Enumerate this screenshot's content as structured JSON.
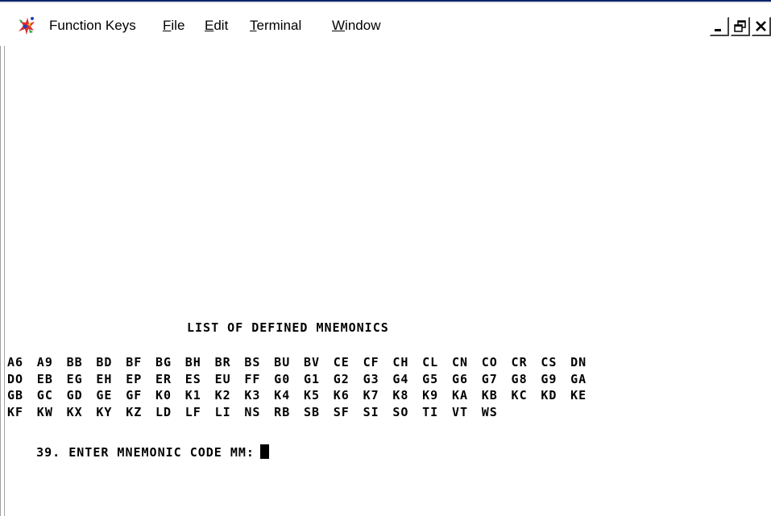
{
  "menubar": {
    "app_icon": "colorful-swirl-app-icon",
    "items": [
      {
        "label": "Function Keys",
        "accel": ""
      },
      {
        "label": "File",
        "accel": "F"
      },
      {
        "label": "Edit",
        "accel": "E"
      },
      {
        "label": "Terminal",
        "accel": "T"
      },
      {
        "label": "Window",
        "accel": "W"
      }
    ],
    "window_controls": [
      "minimize-icon",
      "restore-icon",
      "close-icon"
    ]
  },
  "terminal": {
    "list_title": "LIST OF DEFINED MNEMONICS",
    "mnemonic_rows": [
      [
        "A6",
        "A9",
        "BB",
        "BD",
        "BF",
        "BG",
        "BH",
        "BR",
        "BS",
        "BU",
        "BV",
        "CE",
        "CF",
        "CH",
        "CL",
        "CN",
        "CO",
        "CR",
        "CS",
        "DN"
      ],
      [
        "DO",
        "EB",
        "EG",
        "EH",
        "EP",
        "ER",
        "ES",
        "EU",
        "FF",
        "G0",
        "G1",
        "G2",
        "G3",
        "G4",
        "G5",
        "G6",
        "G7",
        "G8",
        "G9",
        "GA"
      ],
      [
        "GB",
        "GC",
        "GD",
        "GE",
        "GF",
        "K0",
        "K1",
        "K2",
        "K3",
        "K4",
        "K5",
        "K6",
        "K7",
        "K8",
        "K9",
        "KA",
        "KB",
        "KC",
        "KD",
        "KE"
      ],
      [
        "KF",
        "KW",
        "KX",
        "KY",
        "KZ",
        "LD",
        "LF",
        "LI",
        "NS",
        "RB",
        "SB",
        "SF",
        "SI",
        "SO",
        "TI",
        "VT",
        "WS"
      ]
    ],
    "prompt": "39. ENTER MNEMONIC CODE MM:",
    "input_value": ""
  },
  "colors": {
    "background": "#ffffff",
    "text": "#000000",
    "title_bar_edge": "#0a246a"
  }
}
